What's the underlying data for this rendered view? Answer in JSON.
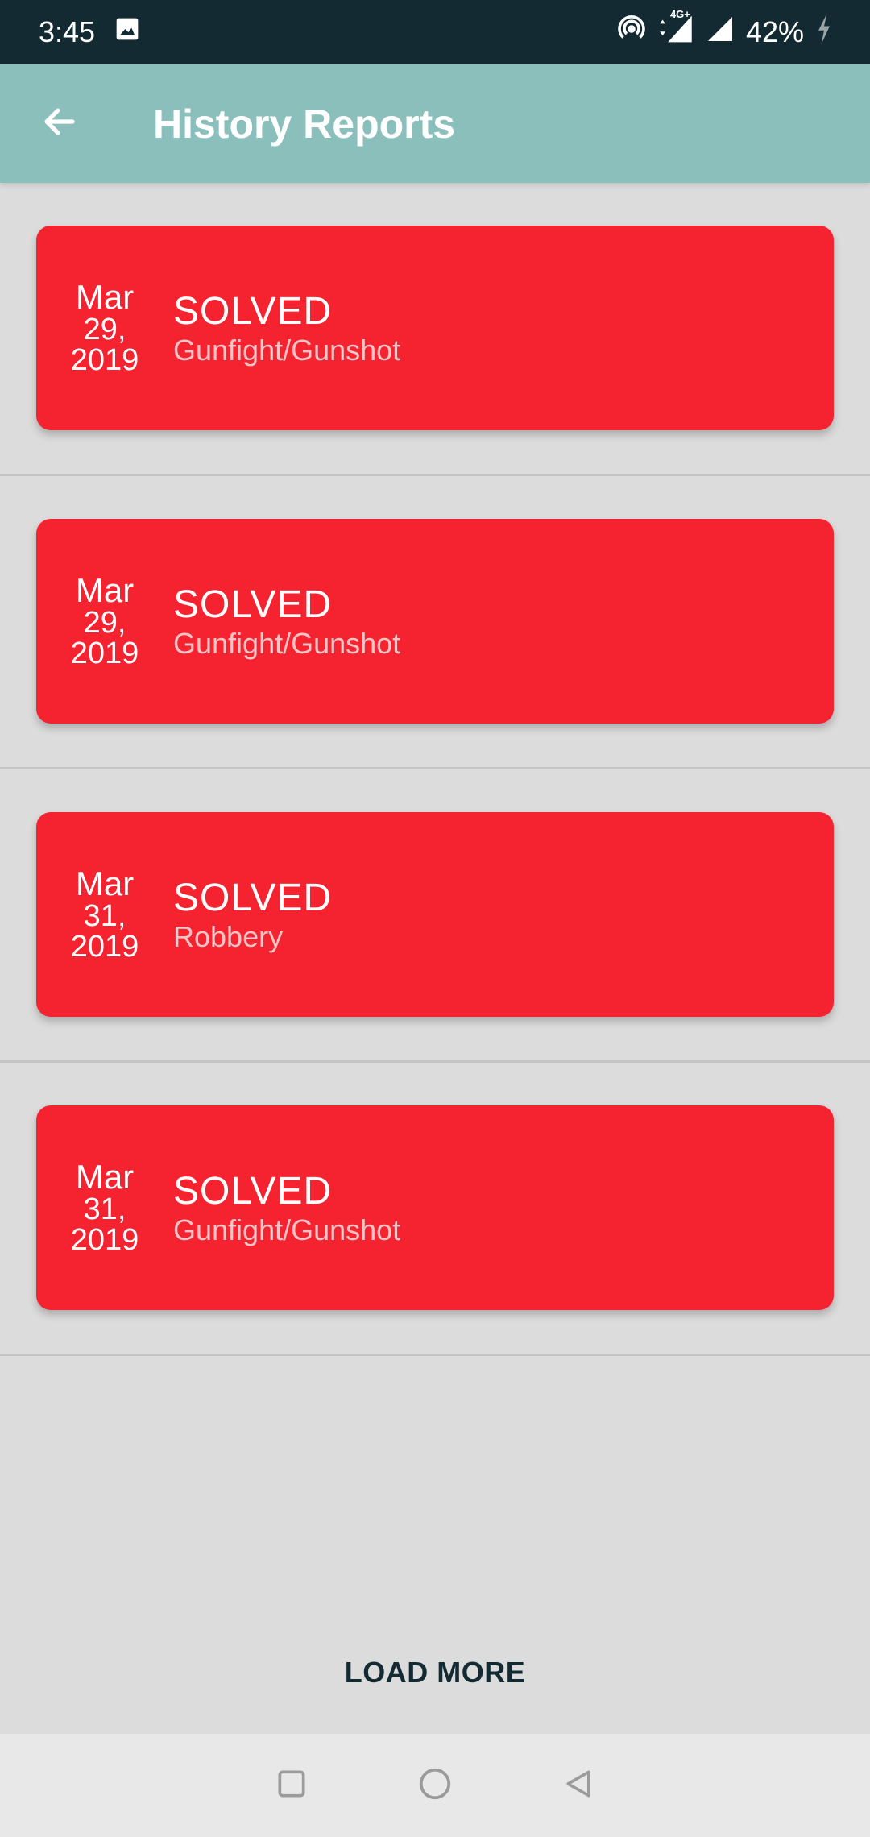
{
  "status_bar": {
    "time": "3:45",
    "network": "4G+",
    "battery": "42%",
    "icons": [
      "image-icon",
      "hotspot-icon",
      "signal-icon",
      "signal-icon",
      "charging-icon"
    ]
  },
  "toolbar": {
    "title": "History Reports",
    "back_icon": "arrow-left-icon",
    "color": "#8bbfbb"
  },
  "reports": [
    {
      "month": "Mar",
      "day": "29,",
      "year": "2019",
      "status": "SOLVED",
      "category": "Gunfight/Gunshot"
    },
    {
      "month": "Mar",
      "day": "29,",
      "year": "2019",
      "status": "SOLVED",
      "category": "Gunfight/Gunshot"
    },
    {
      "month": "Mar",
      "day": "31,",
      "year": "2019",
      "status": "SOLVED",
      "category": "Robbery"
    },
    {
      "month": "Mar",
      "day": "31,",
      "year": "2019",
      "status": "SOLVED",
      "category": "Gunfight/Gunshot"
    }
  ],
  "card_color": "#f5222f",
  "load_more_label": "LOAD MORE",
  "nav_bar": {
    "icons": [
      "recents-square-icon",
      "home-circle-icon",
      "back-triangle-icon"
    ]
  }
}
